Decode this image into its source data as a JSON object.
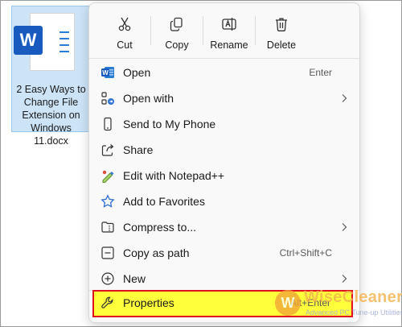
{
  "file": {
    "name_lines": [
      "2 Easy Ways to",
      "Change File",
      "Extension on",
      "Windows 11.docx"
    ],
    "badge_letter": "W",
    "icon": "word-document-icon"
  },
  "quick_actions": [
    {
      "label": "Cut",
      "icon": "scissors-icon"
    },
    {
      "label": "Copy",
      "icon": "copy-icon"
    },
    {
      "label": "Rename",
      "icon": "rename-icon"
    },
    {
      "label": "Delete",
      "icon": "trash-icon"
    }
  ],
  "menu_items": [
    {
      "label": "Open",
      "shortcut": "Enter",
      "icon": "word-app-icon",
      "submenu": false
    },
    {
      "label": "Open with",
      "shortcut": "",
      "icon": "open-with-icon",
      "submenu": true
    },
    {
      "label": "Send to My Phone",
      "shortcut": "",
      "icon": "phone-icon",
      "submenu": false
    },
    {
      "label": "Share",
      "shortcut": "",
      "icon": "share-icon",
      "submenu": false
    },
    {
      "label": "Edit with Notepad++",
      "shortcut": "",
      "icon": "notepad-plus-plus-icon",
      "submenu": false
    },
    {
      "label": "Add to Favorites",
      "shortcut": "",
      "icon": "star-icon",
      "submenu": false
    },
    {
      "label": "Compress to...",
      "shortcut": "",
      "icon": "compress-folder-icon",
      "submenu": true
    },
    {
      "label": "Copy as path",
      "shortcut": "Ctrl+Shift+C",
      "icon": "copy-path-icon",
      "submenu": false
    },
    {
      "label": "New",
      "shortcut": "",
      "icon": "plus-circle-icon",
      "submenu": true
    },
    {
      "label": "Properties",
      "shortcut": "Alt+Enter",
      "icon": "wrench-icon",
      "submenu": false,
      "highlighted": true
    }
  ],
  "watermark": {
    "brand": "WiseCleaner",
    "tagline": "Advanced PC Tune-up Utilities",
    "logo_letter": "W"
  },
  "colors": {
    "highlight_fill": "#ffff3c",
    "highlight_border": "#e0101c",
    "accent": "#185abd"
  }
}
